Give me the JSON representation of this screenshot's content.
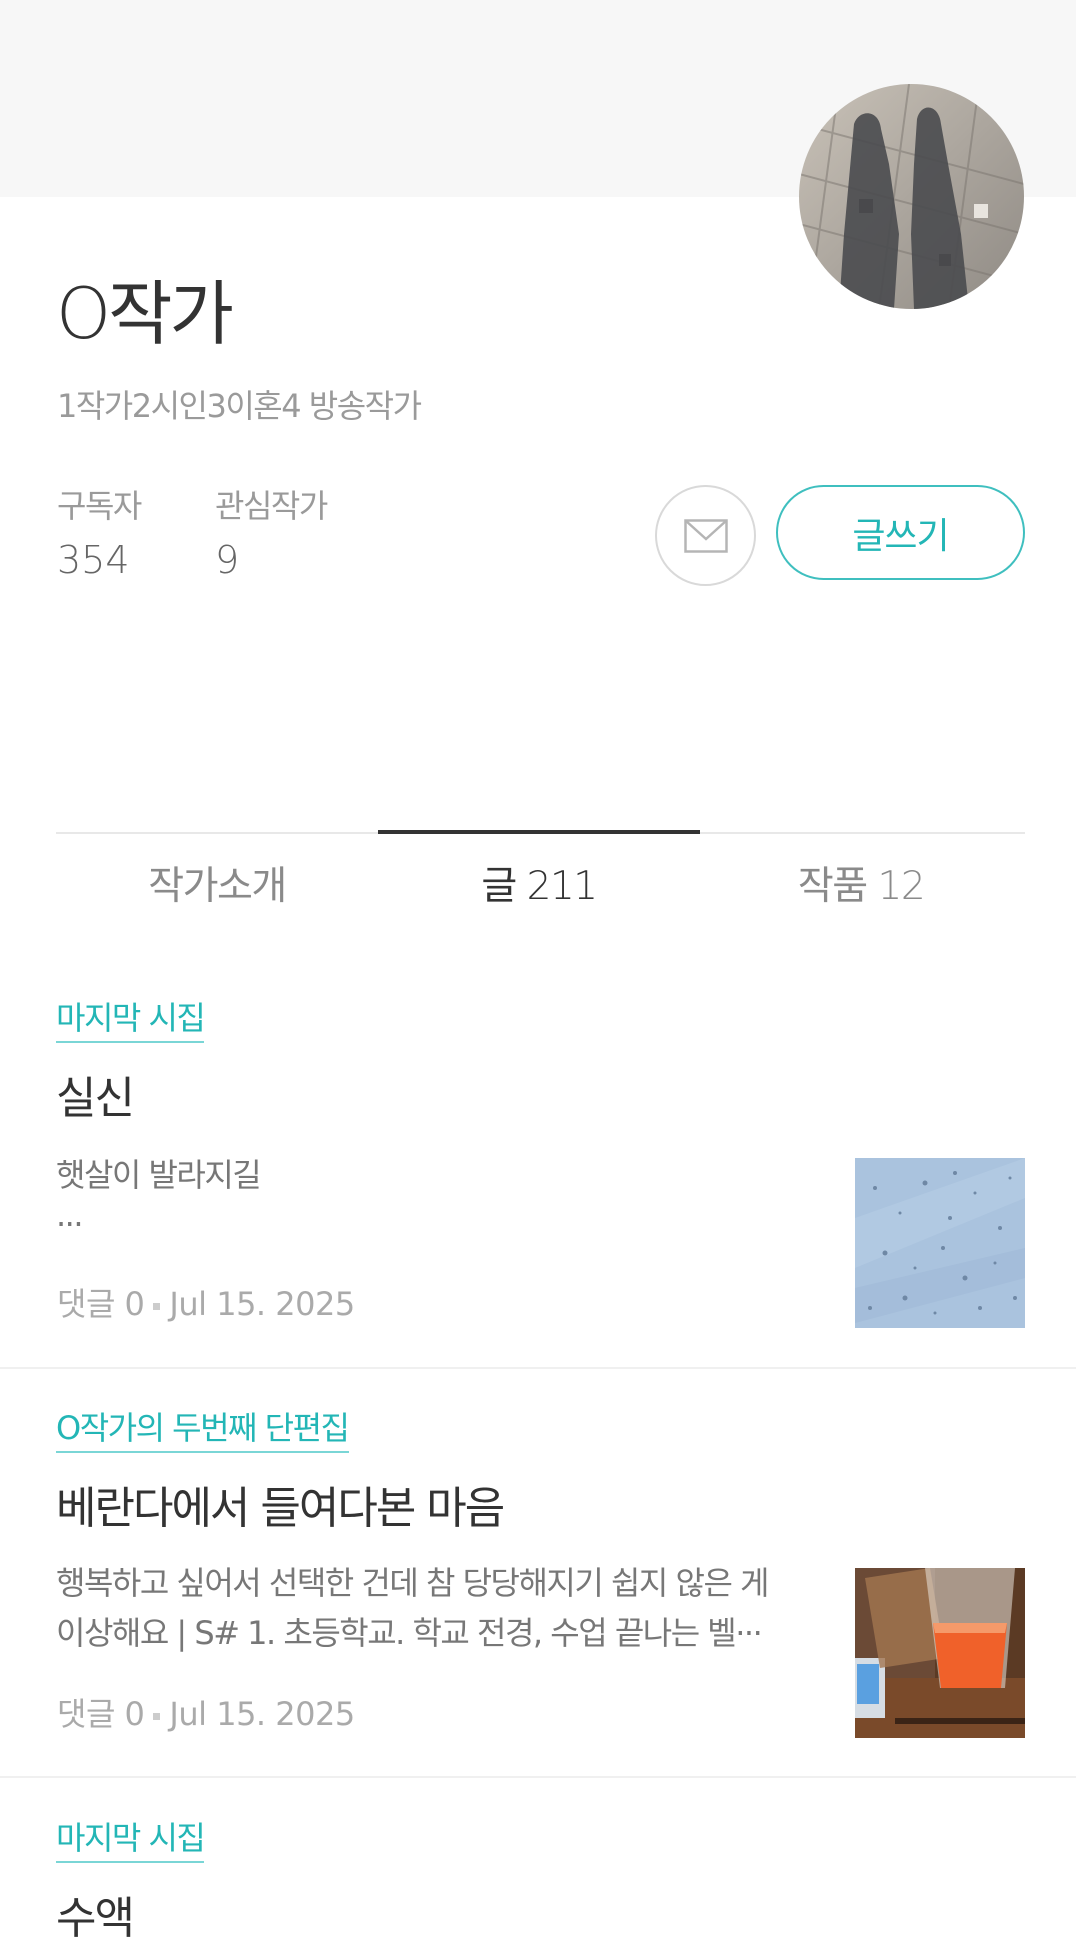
{
  "author": {
    "name": "O작가",
    "description": "1작가2시인3이혼4 방송작가",
    "stats": {
      "subscribers_label": "구독자",
      "subscribers_value": "354",
      "interest_label": "관심작가",
      "interest_value": "9"
    }
  },
  "actions": {
    "write_label": "글쓰기"
  },
  "tabs": [
    {
      "label": "작가소개",
      "active": false
    },
    {
      "label": "글 211",
      "active": true
    },
    {
      "label": "작품 12",
      "active": false
    }
  ],
  "posts": [
    {
      "magazine": "마지막 시집",
      "title": "실신",
      "excerpt_line1": "햇살이 발라지길",
      "excerpt_line2": "...",
      "comments": "댓글 0",
      "date": "Jul 15. 2025"
    },
    {
      "magazine": "O작가의 두번째 단편집",
      "title": "베란다에서 들여다본 마음",
      "excerpt_line1": "행복하고 싶어서 선택한 건데 참 당당해지기 쉽지 않은 게",
      "excerpt_line2": "이상해요 | S# 1. 초등학교. 학교 전경, 수업 끝나는 벨···",
      "comments": "댓글 0",
      "date": "Jul 15. 2025"
    },
    {
      "magazine": "마지막 시집",
      "title": "수액"
    }
  ],
  "colors": {
    "accent": "#23b6b6",
    "text": "#333333",
    "muted": "#9a9a9a"
  },
  "icons": {
    "mail": "envelope-icon"
  }
}
